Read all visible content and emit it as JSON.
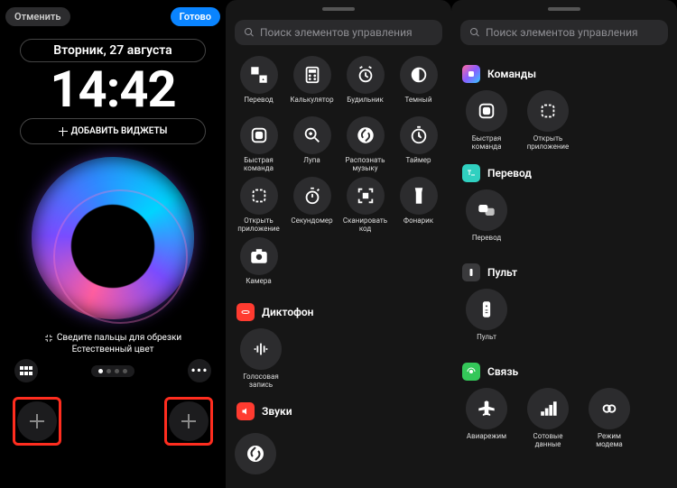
{
  "left": {
    "cancel": "Отменить",
    "done": "Готово",
    "date": "Вторник, 27 августа",
    "time": "14:42",
    "add_widgets": "ДОБАВИТЬ ВИДЖЕТЫ",
    "pinch_hint": "Сведите пальцы для обрезки",
    "color_hint": "Естественный цвет"
  },
  "search_placeholder": "Поиск элементов управления",
  "mid": {
    "controls": [
      {
        "key": "translate",
        "label": "Перевод"
      },
      {
        "key": "calculator",
        "label": "Калькулятор"
      },
      {
        "key": "alarm",
        "label": "Будильник"
      },
      {
        "key": "dark",
        "label": "Темный"
      },
      {
        "key": "shortcut",
        "label": "Быстрая команда"
      },
      {
        "key": "magnifier",
        "label": "Лупа"
      },
      {
        "key": "shazam",
        "label": "Распознать музыку"
      },
      {
        "key": "timer",
        "label": "Таймер"
      },
      {
        "key": "openapp",
        "label": "Открыть приложение"
      },
      {
        "key": "stopwatch",
        "label": "Секундомер"
      },
      {
        "key": "scan",
        "label": "Сканировать код"
      },
      {
        "key": "flashlight",
        "label": "Фонарик"
      },
      {
        "key": "camera",
        "label": "Камера"
      }
    ],
    "sections": [
      {
        "badge": "red",
        "title": "Диктофон"
      },
      {
        "items": [
          {
            "key": "voicememo",
            "label": "Голосовая запись"
          }
        ]
      },
      {
        "badge": "red",
        "title": "Звуки"
      }
    ],
    "voicememo_title": "Диктофон",
    "voicememo_label": "Голосовая запись",
    "sounds_title": "Звуки"
  },
  "right": {
    "sections": {
      "shortcuts": {
        "title": "Команды",
        "items": [
          {
            "key": "shortcut",
            "label": "Быстрая команда"
          },
          {
            "key": "openapp",
            "label": "Открыть приложение"
          }
        ]
      },
      "translate": {
        "title": "Перевод",
        "items": [
          {
            "key": "translate",
            "label": "Перевод"
          }
        ]
      },
      "remote": {
        "title": "Пульт",
        "items": [
          {
            "key": "remote",
            "label": "Пульт"
          }
        ]
      },
      "connectivity": {
        "title": "Связь",
        "items": [
          {
            "key": "airplane",
            "label": "Авиарежим"
          },
          {
            "key": "cellular",
            "label": "Сотовые данные"
          },
          {
            "key": "hotspot",
            "label": "Режим модема"
          }
        ]
      }
    }
  }
}
